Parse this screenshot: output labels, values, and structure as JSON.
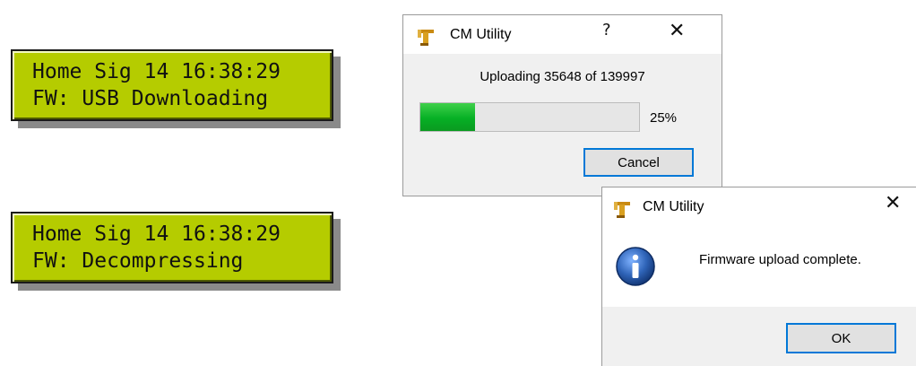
{
  "lcd_panels": [
    {
      "line1": "Home Sig 14 16:38:29",
      "line2": "FW: USB Downloading"
    },
    {
      "line1": "Home Sig 14 16:38:29",
      "line2": "FW: Decompressing"
    }
  ],
  "progress_dialog": {
    "title": "CM Utility",
    "help_label": "?",
    "close_label": "✕",
    "status_text": "Uploading 35648 of 139997",
    "progress_fraction": 0.25,
    "percent_label": "25%",
    "cancel_label": "Cancel",
    "icons": {
      "app": "cm-utility-app-icon",
      "help": "help-icon",
      "close": "close-icon"
    }
  },
  "info_dialog": {
    "title": "CM Utility",
    "close_label": "✕",
    "message": "Firmware upload complete.",
    "ok_label": "OK",
    "icons": {
      "app": "cm-utility-app-icon",
      "info": "info-icon",
      "close": "close-icon"
    }
  },
  "colors": {
    "lcd_background": "#b5cc00",
    "progress_fill": "#06b025",
    "focus_border": "#0078d7",
    "info_icon_blue": "#2f64b8"
  }
}
